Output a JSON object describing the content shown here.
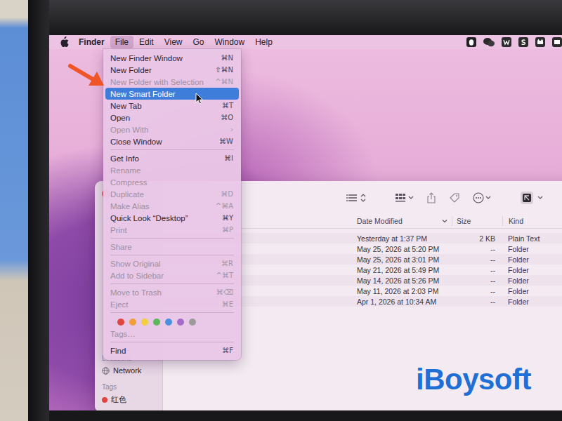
{
  "menu_bar": {
    "app": "Finder",
    "items": [
      {
        "label": "File",
        "selected": true
      },
      {
        "label": "Edit",
        "selected": false
      },
      {
        "label": "View",
        "selected": false
      },
      {
        "label": "Go",
        "selected": false
      },
      {
        "label": "Window",
        "selected": false
      },
      {
        "label": "Help",
        "selected": false
      }
    ]
  },
  "file_menu": {
    "items": [
      {
        "kind": "item",
        "label": "New Finder Window",
        "shortcut": "⌘N",
        "disabled": false,
        "selected": false
      },
      {
        "kind": "item",
        "label": "New Folder",
        "shortcut": "⇧⌘N",
        "disabled": false,
        "selected": false
      },
      {
        "kind": "item",
        "label": "New Folder with Selection",
        "shortcut": "^⌘N",
        "disabled": true,
        "selected": false
      },
      {
        "kind": "item",
        "label": "New Smart Folder",
        "disabled": false,
        "selected": true
      },
      {
        "kind": "item",
        "label": "New Tab",
        "shortcut": "⌘T",
        "disabled": false,
        "selected": false
      },
      {
        "kind": "item",
        "label": "Open",
        "shortcut": "⌘O",
        "disabled": false,
        "selected": false
      },
      {
        "kind": "item",
        "label": "Open With",
        "shortcut": "›",
        "disabled": true,
        "selected": false
      },
      {
        "kind": "item",
        "label": "Close Window",
        "shortcut": "⌘W",
        "disabled": false,
        "selected": false
      },
      {
        "kind": "separator"
      },
      {
        "kind": "item",
        "label": "Get Info",
        "shortcut": "⌘I",
        "disabled": false,
        "selected": false
      },
      {
        "kind": "item",
        "label": "Rename",
        "disabled": true,
        "selected": false
      },
      {
        "kind": "item",
        "label": "Compress",
        "disabled": true,
        "selected": false
      },
      {
        "kind": "item",
        "label": "Duplicate",
        "shortcut": "⌘D",
        "disabled": true,
        "selected": false
      },
      {
        "kind": "item",
        "label": "Make Alias",
        "shortcut": "^⌘A",
        "disabled": true,
        "selected": false
      },
      {
        "kind": "item",
        "label": "Quick Look “Desktop”",
        "shortcut": "⌘Y",
        "disabled": false,
        "selected": false
      },
      {
        "kind": "item",
        "label": "Print",
        "shortcut": "⌘P",
        "disabled": true,
        "selected": false
      },
      {
        "kind": "separator"
      },
      {
        "kind": "item",
        "label": "Share",
        "disabled": true,
        "selected": false
      },
      {
        "kind": "separator"
      },
      {
        "kind": "item",
        "label": "Show Original",
        "shortcut": "⌘R",
        "disabled": true,
        "selected": false
      },
      {
        "kind": "item",
        "label": "Add to Sidebar",
        "shortcut": "^⌘T",
        "disabled": true,
        "selected": false
      },
      {
        "kind": "separator"
      },
      {
        "kind": "item",
        "label": "Move to Trash",
        "shortcut": "⌘⌫",
        "disabled": true,
        "selected": false
      },
      {
        "kind": "item",
        "label": "Eject",
        "shortcut": "⌘E",
        "disabled": true,
        "selected": false
      },
      {
        "kind": "separator"
      },
      {
        "kind": "tags",
        "colors": [
          {
            "color": "#e0453f"
          },
          {
            "color": "#f0a03a"
          },
          {
            "color": "#f2cf3c"
          },
          {
            "color": "#5cb85c"
          },
          {
            "color": "#4a8fe0"
          },
          {
            "color": "#a46bc9"
          },
          {
            "color": "#9a9a9a"
          }
        ]
      },
      {
        "kind": "item",
        "label": "Tags…",
        "disabled": true,
        "selected": false
      },
      {
        "kind": "separator"
      },
      {
        "kind": "item",
        "label": "Find",
        "shortcut": "⌘F",
        "disabled": false,
        "selected": false
      }
    ]
  },
  "finder_window": {
    "sidebar": [
      {
        "kind": "header",
        "label": "Locations"
      },
      {
        "kind": "item",
        "label": "Network"
      },
      {
        "kind": "header",
        "label": "Tags"
      },
      {
        "kind": "tag",
        "label": "红色",
        "color": "#e0453f"
      }
    ],
    "table": {
      "columns": [
        {
          "label": "Date Modified",
          "sorted": true
        },
        {
          "label": "Size",
          "sorted": false
        },
        {
          "label": "Kind",
          "sorted": false
        }
      ],
      "rows": [
        [
          "Yesterday at 1:37 PM",
          "2 KB",
          "Plain Text"
        ],
        [
          "May 25, 2026 at 5:20 PM",
          "--",
          "Folder"
        ],
        [
          "May 25, 2026 at 3:01 PM",
          "--",
          "Folder"
        ],
        [
          "May 21, 2026 at 5:49 PM",
          "--",
          "Folder"
        ],
        [
          "May 14, 2026 at 5:26 PM",
          "--",
          "Folder"
        ],
        [
          "May 11, 2026 at 2:03 PM",
          "--",
          "Folder"
        ],
        [
          "Apr 1, 2026 at 10:34 AM",
          "--",
          "Folder"
        ]
      ]
    }
  },
  "watermark": "iBoysoft"
}
